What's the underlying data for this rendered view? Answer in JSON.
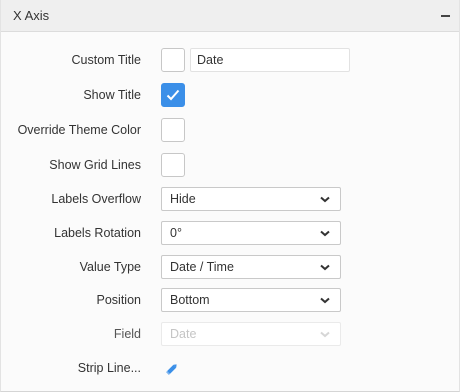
{
  "panel": {
    "title": "X Axis",
    "collapse_icon": "minus-icon"
  },
  "fields": {
    "custom_title": {
      "label": "Custom Title",
      "checked": false,
      "value": "Date"
    },
    "show_title": {
      "label": "Show Title",
      "checked": true
    },
    "override_theme_color": {
      "label": "Override Theme Color",
      "checked": false
    },
    "show_grid_lines": {
      "label": "Show Grid Lines",
      "checked": false
    },
    "labels_overflow": {
      "label": "Labels Overflow",
      "value": "Hide"
    },
    "labels_rotation": {
      "label": "Labels Rotation",
      "value": "0°"
    },
    "value_type": {
      "label": "Value Type",
      "value": "Date / Time"
    },
    "position": {
      "label": "Position",
      "value": "Bottom"
    },
    "field": {
      "label": "Field",
      "value": "Date",
      "disabled": true
    },
    "strip_line": {
      "label": "Strip Line...",
      "icon": "pencil-icon"
    }
  },
  "colors": {
    "accent": "#3b8fe8",
    "header_bg": "#efefef",
    "panel_bg": "#fbfbfb"
  }
}
